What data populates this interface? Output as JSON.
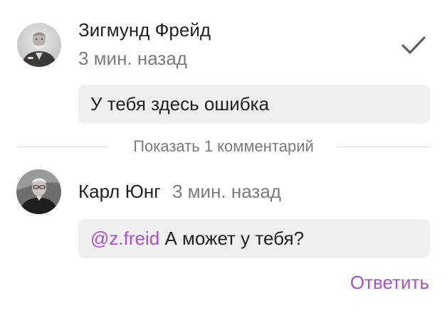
{
  "comments": [
    {
      "author": "Зигмунд Фрейд",
      "time": "3 мин. назад",
      "text": "У тебя здесь ошибка",
      "status_icon": "check-icon",
      "avatar_icon": "avatar-photo"
    },
    {
      "author": "Карл Юнг",
      "time": "3 мин. назад",
      "mention": "@z.freid",
      "text": "А может у тебя?",
      "avatar_icon": "avatar-photo"
    }
  ],
  "thread": {
    "show_more_label": "Показать 1 комментарий"
  },
  "actions": {
    "reply_label": "Ответить"
  },
  "colors": {
    "accent": "#a552c8",
    "bubble": "#efefef",
    "muted_text": "#7a7a7a",
    "check": "#5f5f5f"
  }
}
